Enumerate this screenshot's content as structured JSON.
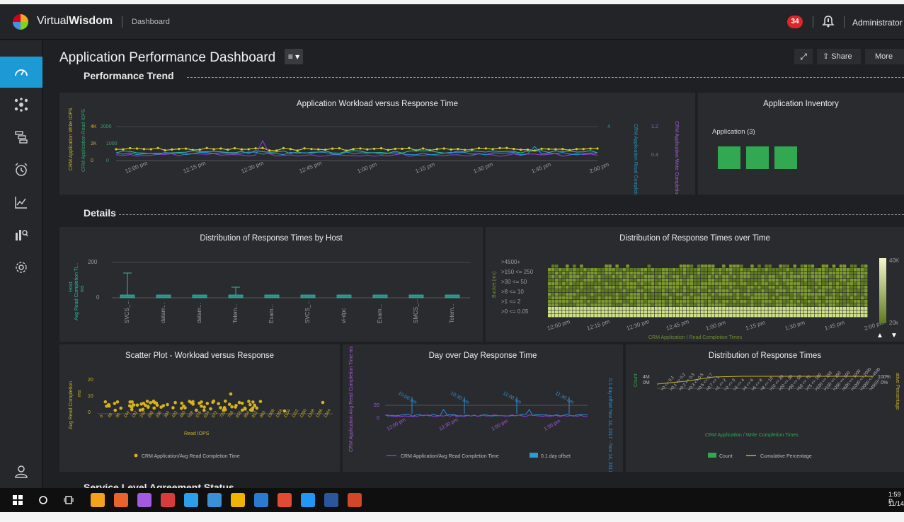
{
  "header": {
    "app_name_light": "Virtual",
    "app_name_bold": "Wisdom",
    "breadcrumb": "Dashboard",
    "alert_count": "34",
    "user": "Administrator"
  },
  "sidebar": {
    "items": [
      {
        "icon": "speedometer-icon",
        "active": true
      },
      {
        "icon": "topology-icon",
        "active": false
      },
      {
        "icon": "hierarchy-icon",
        "active": false
      },
      {
        "icon": "alarm-clock-icon",
        "active": false
      },
      {
        "icon": "line-chart-icon",
        "active": false
      },
      {
        "icon": "bar-chart-search-icon",
        "active": false
      },
      {
        "icon": "gear-icon",
        "active": false
      }
    ],
    "bottom_icon": "user-icon"
  },
  "toolbar": {
    "page_title": "Application Performance Dashboard",
    "menu_glyph": "≡ ▾",
    "share_label": "Share",
    "more_label": "More"
  },
  "sections": {
    "performance_trend": "Performance Trend",
    "details": "Details",
    "sla": "Service Level Agreement Status"
  },
  "panels": {
    "workload": {
      "title": "Application Workload versus Response Time",
      "y_left_outer": "CRM Application Write IOPS",
      "y_left_inner": "CRM Application Read IOPS",
      "y_right_inner": "CRM Application Read Completion Time",
      "y_right_outer": "CRM Application Write Completion Time",
      "ticks_left": [
        "4K",
        "2K",
        "0"
      ],
      "ticks_left2": [
        "2000",
        "1000",
        "0"
      ],
      "ticks_right": [
        "1.2",
        "0.4"
      ],
      "x_ticks": [
        "12:00 pm",
        "12:15 pm",
        "12:30 pm",
        "12:45 pm",
        "1:00 pm",
        "1:15 pm",
        "1:30 pm",
        "1:45 pm",
        "2:00 pm"
      ]
    },
    "inventory": {
      "title": "Application Inventory",
      "label": "Application (3)",
      "tile_count": 3
    },
    "dist_host": {
      "title": "Distribution of Response Times by Host",
      "y_label_1": "Host",
      "y_label_2": "Avg Read Completion Ti...",
      "y_label_3": "ms",
      "y_ticks": [
        "200",
        "0"
      ],
      "hosts": [
        "SVCS_...",
        "datam...",
        "datam...",
        "Telem...",
        "Exam...",
        "SVCS_...",
        "vi-dpc",
        "Exam...",
        "SMCS_...",
        "Telem..."
      ]
    },
    "dist_time": {
      "title": "Distribution of Response Times over Time",
      "y_label": "Bucket (ms)",
      "buckets": [
        ">4500+",
        ">150 <= 250",
        ">30 <= 50",
        ">8 <= 10",
        ">1 <= 2",
        ">0 <= 0.05"
      ],
      "x_ticks": [
        "12:00 pm",
        "12:15 pm",
        "12:30 pm",
        "12:45 pm",
        "1:00 pm",
        "1:15 pm",
        "1:30 pm",
        "1:45 pm",
        "2:00 pm"
      ],
      "x_label": "CRM Application / Read Completion Times",
      "scale_max": "40K",
      "scale_min": "20k"
    },
    "scatter": {
      "title": "Scatter Plot - Workload versus Response",
      "y_label": "Avg Read Completion",
      "y_unit": "ms",
      "y_ticks": [
        "20",
        "10",
        "0"
      ],
      "x_label": "Read IOPS",
      "x_ticks": [
        "0",
        "48",
        "96",
        "144",
        "192",
        "240",
        "288",
        "336",
        "384",
        "432",
        "480",
        "528",
        "576",
        "624",
        "672",
        "720",
        "768",
        "816",
        "864",
        "912",
        "960",
        "1008",
        "1056",
        "1104",
        "1152",
        "1200",
        "1248",
        "1296",
        "1344"
      ],
      "legend": "CRM Application/Avg Read Completion Time"
    },
    "day_over_day": {
      "title": "Day over Day Response Time",
      "y_label": "CRM Application Avg Read Completion Time ms",
      "y_ticks": [
        "20",
        "0"
      ],
      "y_right_label": "0.1 day offset Nov 14, 2017 - Nov 14, 2017 ms",
      "top_ticks": [
        "10:00 am",
        "10:30 am",
        "11:00 am",
        "11:30 am"
      ],
      "bottom_ticks": [
        "12:00 pm",
        "12:30 pm",
        "1:00 pm",
        "1:30 pm"
      ],
      "legend_1": "CRM Application/Avg Read Completion Time",
      "legend_2": "0.1 day offset"
    },
    "dist_resp": {
      "title": "Distribution of Response Times",
      "y_label": "Count",
      "y_ticks": [
        "4M",
        "0M"
      ],
      "y_right_label": "ative Percentage",
      "y_right_ticks": [
        "100%",
        "0%"
      ],
      "x_ticks": [
        ">0 <= 0.1",
        ">0.1 <= 0.2",
        ">0.2 <= 0.3",
        ">0.3 <= 0.5",
        ">0.5 <= 0.7",
        ">0.7 <= 1",
        ">1 <= 2",
        ">2 <= 3",
        ">3 <= 4",
        ">4 <= 6",
        ">6 <= 8",
        ">8 <= 10",
        ">10 <= 20",
        ">20 <= 30",
        ">30 <= 50",
        ">50 <= 75",
        ">75 <= 100",
        ">100 <= 150",
        ">150 <= 250",
        ">250 <= 500",
        ">500 <= 1000",
        ">1000 <= 2000",
        ">2000 <= 4500",
        ">4500+"
      ],
      "x_label": "CRM Application / Write Completion Times",
      "legend_1": "Count",
      "legend_2": "Cumulative Percentage"
    }
  },
  "taskbar": {
    "time": "1:59 P",
    "date": "11/14/",
    "apps": [
      {
        "icon": "file-explorer-icon",
        "color": "#f4a21b"
      },
      {
        "icon": "firefox-icon",
        "color": "#e8642c"
      },
      {
        "icon": "paint-icon",
        "color": "#a25be0"
      },
      {
        "icon": "snip-icon",
        "color": "#d83b3b"
      },
      {
        "icon": "chrome-icon",
        "color": "#2b9fe8"
      },
      {
        "icon": "notepad-icon",
        "color": "#3a8fd6"
      },
      {
        "icon": "chrome-alt-icon",
        "color": "#f0b400"
      },
      {
        "icon": "outlook-icon",
        "color": "#2a7ad0"
      },
      {
        "icon": "slides-icon",
        "color": "#e14b33"
      },
      {
        "icon": "skype-icon",
        "color": "#2196f3"
      },
      {
        "icon": "word-icon",
        "color": "#2b579a"
      },
      {
        "icon": "powerpoint-icon",
        "color": "#d24726"
      }
    ]
  }
}
